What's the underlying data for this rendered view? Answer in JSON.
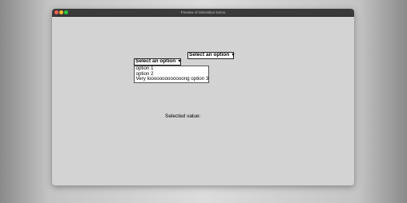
{
  "window": {
    "title": "Preview of SelectBox Demo"
  },
  "select_top": {
    "label": "Select an option",
    "arrow": "▼"
  },
  "select_open": {
    "label": "Select an option",
    "arrow": "▼",
    "options": [
      "option 1",
      "option 2",
      "Very looooooooooooong option 3"
    ]
  },
  "selected": {
    "label": "Selected value:"
  },
  "colors": {
    "window_bg": "#d3d3d3",
    "titlebar": "#3a3a3a",
    "close": "#ff5f57",
    "minimize": "#febc2e",
    "maximize": "#28c840"
  }
}
